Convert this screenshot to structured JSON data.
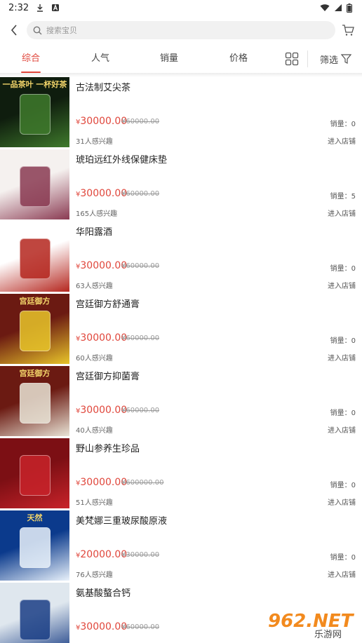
{
  "status": {
    "time": "2:32"
  },
  "search": {
    "placeholder": "搜索宝贝"
  },
  "sort_tabs": [
    "综合",
    "人气",
    "销量",
    "价格"
  ],
  "filter_label": "筛选",
  "products": [
    {
      "name": "古法制艾尖茶",
      "price": "30000.00",
      "original": "¥60000.00",
      "sales": "销量：0",
      "interest": "31人感兴趣",
      "enter": "进入店铺",
      "thumb_banner": "一品茶叶 一杯好茶",
      "thumb_colors": [
        "#0f1d0e",
        "#3f7a2c"
      ]
    },
    {
      "name": "琥珀远红外线保健床垫",
      "price": "30000.00",
      "original": "¥60000.00",
      "sales": "销量：5",
      "interest": "165人感兴趣",
      "enter": "进入店铺",
      "thumb_banner": "",
      "thumb_colors": [
        "#f5f1ef",
        "#8a3a52"
      ]
    },
    {
      "name": "华阳露酒",
      "price": "30000.00",
      "original": "¥60000.00",
      "sales": "销量：0",
      "interest": "63人感兴趣",
      "enter": "进入店铺",
      "thumb_banner": "",
      "thumb_colors": [
        "#ffffff",
        "#b5261e"
      ]
    },
    {
      "name": "宫廷御方舒通膏",
      "price": "30000.00",
      "original": "¥60000.00",
      "sales": "销量：0",
      "interest": "60人感兴趣",
      "enter": "进入店铺",
      "thumb_banner": "宫廷御方",
      "thumb_colors": [
        "#6b1a12",
        "#e8c52a"
      ]
    },
    {
      "name": "宫廷御方抑菌膏",
      "price": "30000.00",
      "original": "¥60000.00",
      "sales": "销量：0",
      "interest": "40人感兴趣",
      "enter": "进入店铺",
      "thumb_banner": "宫廷御方",
      "thumb_colors": [
        "#6b1a12",
        "#e9e4d6"
      ]
    },
    {
      "name": "野山参养生珍品",
      "price": "30000.00",
      "original": "¥600000.00",
      "sales": "销量：0",
      "interest": "51人感兴趣",
      "enter": "进入店铺",
      "thumb_banner": "",
      "thumb_colors": [
        "#7c0f14",
        "#c8232a"
      ]
    },
    {
      "name": "美梵娜三重玻尿酸原液",
      "price": "20000.00",
      "original": "¥30000.00",
      "sales": "销量：0",
      "interest": "76人感兴趣",
      "enter": "进入店铺",
      "thumb_banner": "天然",
      "thumb_colors": [
        "#0b3a8c",
        "#e9f2fb"
      ]
    },
    {
      "name": "氨基酸螯合钙",
      "price": "30000.00",
      "original": "¥60000.00",
      "sales": "",
      "interest": "",
      "enter": "",
      "thumb_banner": "",
      "thumb_colors": [
        "#dfe7ee",
        "#1b3f86"
      ]
    }
  ],
  "watermark": {
    "text": "962.NET",
    "sub": "乐游网"
  },
  "colors": {
    "accent": "#e0463b",
    "muted": "#999999"
  }
}
